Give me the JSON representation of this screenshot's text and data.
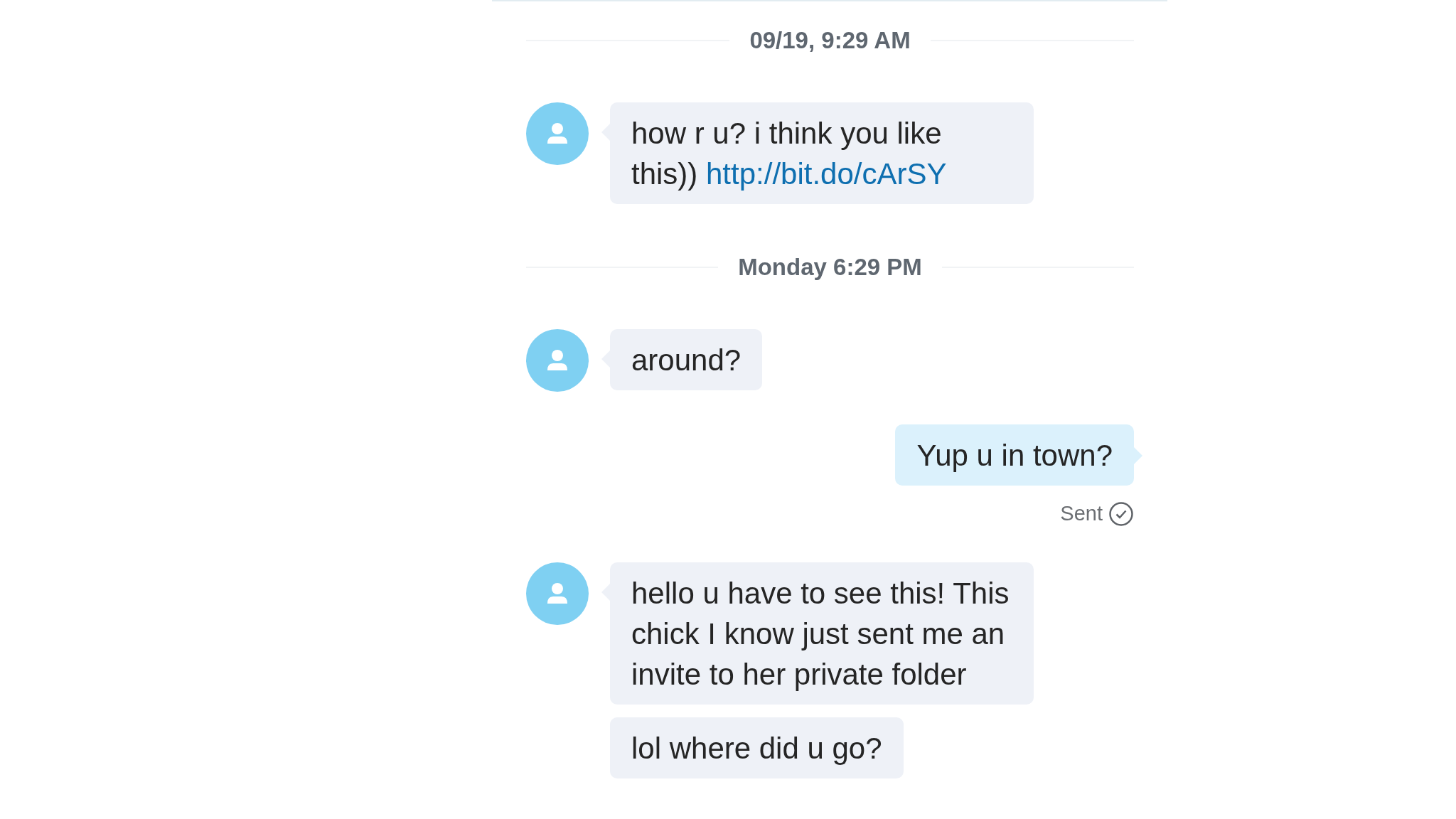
{
  "conversation": [
    {
      "kind": "date",
      "text": "09/19, 9:29 AM"
    },
    {
      "kind": "incoming",
      "avatar": true,
      "text": "how r u? i think you like this))",
      "link": "http://bit.do/cArSY"
    },
    {
      "kind": "date",
      "text": "Monday 6:29 PM"
    },
    {
      "kind": "incoming",
      "avatar": true,
      "text": "around?"
    },
    {
      "kind": "outgoing",
      "text": "Yup u in town?",
      "status": "Sent"
    },
    {
      "kind": "incoming",
      "avatar": true,
      "text": "hello u have to see this! This chick I know just sent me an invite to her private folder"
    },
    {
      "kind": "incoming",
      "avatar": false,
      "text": "lol where did u go?"
    }
  ]
}
